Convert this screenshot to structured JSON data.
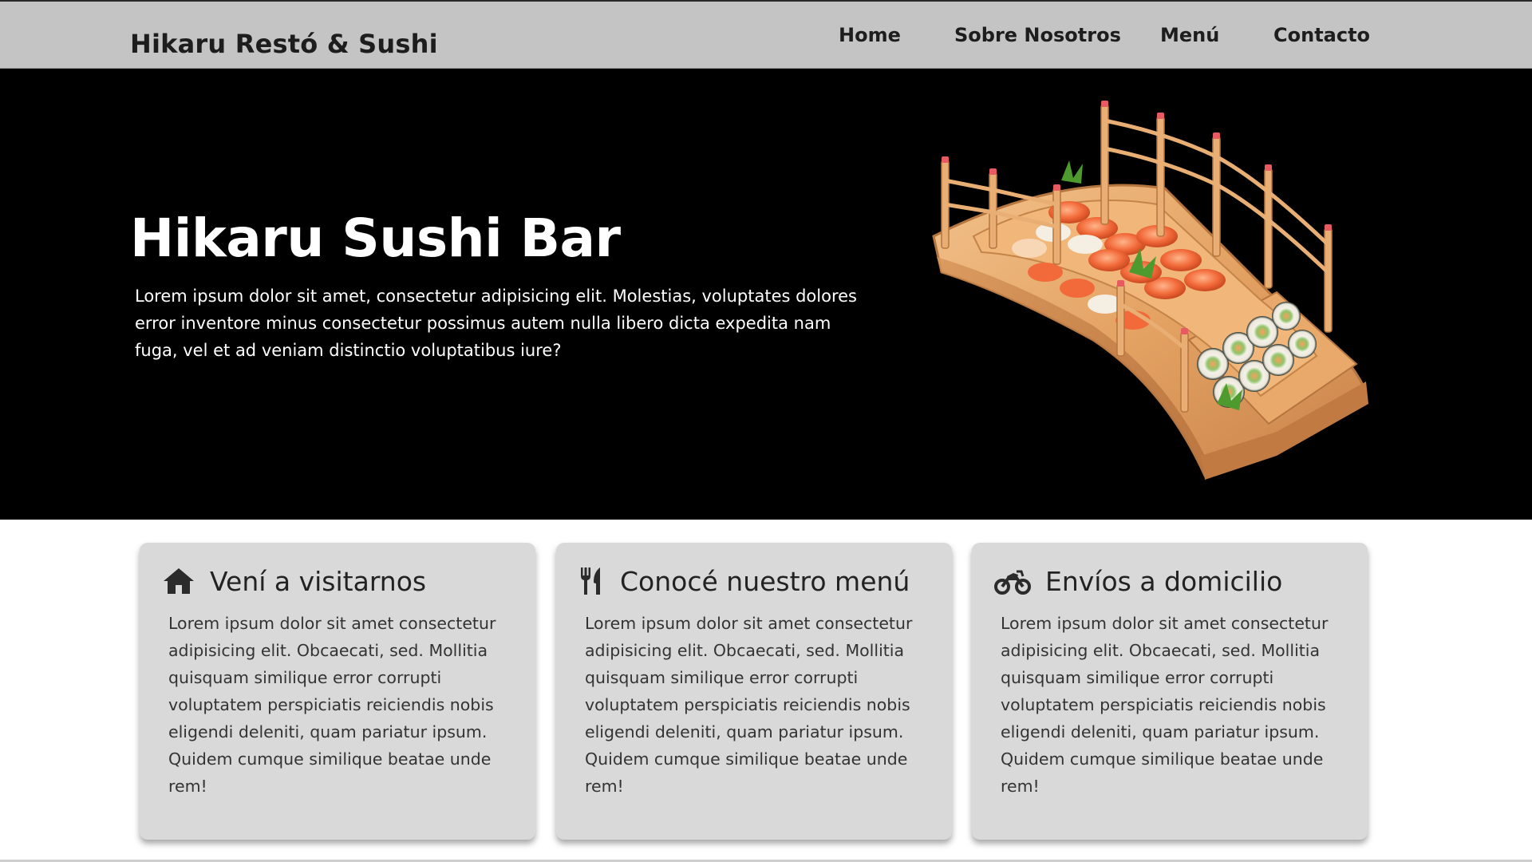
{
  "header": {
    "brand": "Hikaru Restó & Sushi",
    "nav": [
      "Home",
      "Sobre Nosotros",
      "Menú",
      "Contacto"
    ]
  },
  "hero": {
    "title": "Hikaru Sushi Bar",
    "text": "Lorem ipsum dolor sit amet, consectetur adipisicing elit. Molestias, voluptates dolores error inventore minus consectetur possimus autem nulla libero dicta expedita nam fuga, vel et ad veniam distinctio voluptatibus iure?",
    "image_icon": "sushi-bridge-platter-image"
  },
  "cards": [
    {
      "icon": "house-icon",
      "title": "Vení a visitarnos",
      "text": "Lorem ipsum dolor sit amet consectetur adipisicing elit. Obcaecati, sed. Mollitia quisquam similique error corrupti voluptatem perspiciatis reiciendis nobis eligendi deleniti, quam pariatur ipsum. Quidem cumque similique beatae unde rem!"
    },
    {
      "icon": "utensils-icon",
      "title": "Conocé nuestro menú",
      "text": "Lorem ipsum dolor sit amet consectetur adipisicing elit. Obcaecati, sed. Mollitia quisquam similique error corrupti voluptatem perspiciatis reiciendis nobis eligendi deleniti, quam pariatur ipsum. Quidem cumque similique beatae unde rem!"
    },
    {
      "icon": "motorcycle-icon",
      "title": "Envíos a domicilio",
      "text": "Lorem ipsum dolor sit amet consectetur adipisicing elit. Obcaecati, sed. Mollitia quisquam similique error corrupti voluptatem perspiciatis reiciendis nobis eligendi deleniti, quam pariatur ipsum. Quidem cumque similique beatae unde rem!"
    }
  ],
  "colors": {
    "header_bg": "#c4c4c4",
    "hero_bg": "#000000",
    "card_bg": "#d9d9d9",
    "text_dark": "#1d1d1d"
  }
}
